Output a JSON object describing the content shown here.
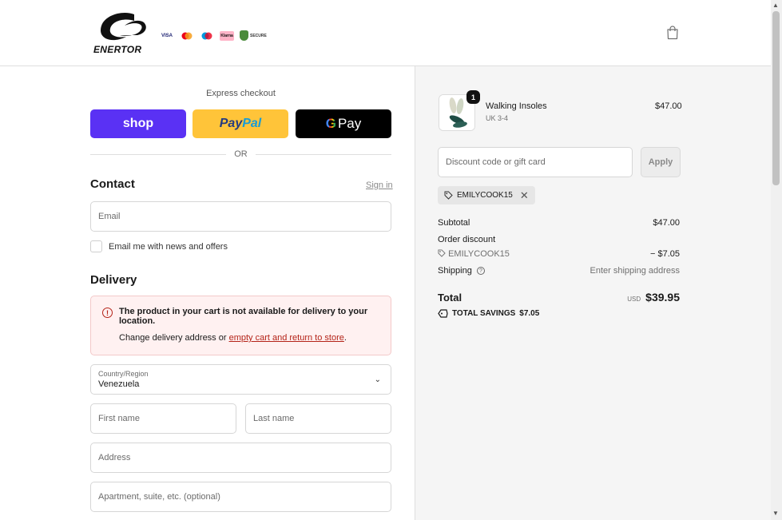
{
  "brand": {
    "name": "ENERTOR"
  },
  "payment_logos": {
    "visa": "VISA",
    "klarna": "Klarna",
    "secure": "SECURE"
  },
  "express": {
    "label": "Express checkout",
    "shop": "shop",
    "paypal_a": "Pay",
    "paypal_b": "Pal",
    "gpay_g": "G",
    "gpay_pay": "Pay",
    "or": "OR"
  },
  "contact": {
    "title": "Contact",
    "sign_in": "Sign in",
    "email_placeholder": "Email",
    "newsletter_label": "Email me with news and offers"
  },
  "delivery": {
    "title": "Delivery",
    "alert_title": "The product in your cart is not available for delivery to your location.",
    "alert_prefix": "Change delivery address or ",
    "alert_link": "empty cart and return to store",
    "alert_suffix": ".",
    "country_label": "Country/Region",
    "country_value": "Venezuela",
    "first_name": "First name",
    "last_name": "Last name",
    "address": "Address",
    "apartment": "Apartment, suite, etc. (optional)"
  },
  "cart": {
    "quantity": "1",
    "product_name": "Walking Insoles",
    "variant": "UK 3-4",
    "price": "$47.00"
  },
  "discount": {
    "placeholder": "Discount code or gift card",
    "apply": "Apply",
    "code": "EMILYCOOK15"
  },
  "summary": {
    "subtotal_label": "Subtotal",
    "subtotal_value": "$47.00",
    "order_discount_label": "Order discount",
    "discount_code": "EMILYCOOK15",
    "discount_value": "− $7.05",
    "shipping_label": "Shipping",
    "shipping_value": "Enter shipping address",
    "total_label": "Total",
    "currency": "USD",
    "total_value": "$39.95",
    "savings_label": "TOTAL SAVINGS",
    "savings_value": "$7.05"
  },
  "colors": {
    "shop": "#5a31f4",
    "paypal": "#ffc439",
    "gpay": "#000000",
    "error": "#b42318"
  }
}
